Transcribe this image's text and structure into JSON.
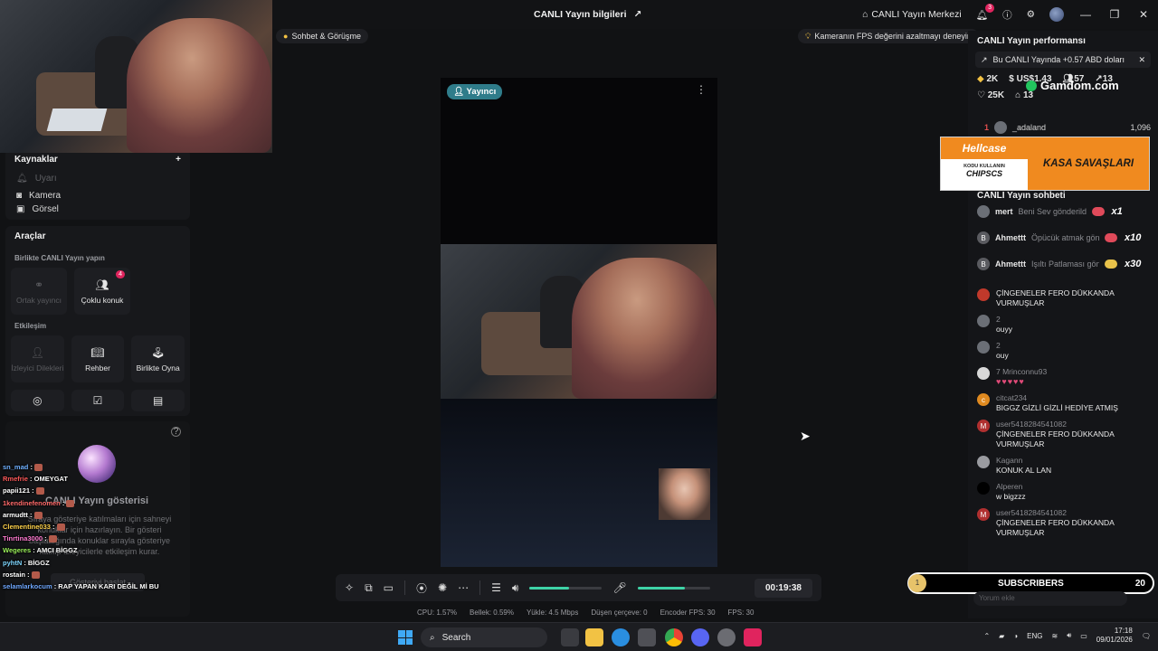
{
  "titlebar": {
    "title": "CANLI Yayın bilgileri",
    "live_center": "CANLI Yayın Merkezi",
    "notif_count": "3",
    "minimize": "—",
    "maximize": "❐",
    "close": "✕"
  },
  "top_chips": {
    "chat_call": "Sohbet & Görüşme",
    "fps_tip": "Kameranın FPS değerini azaltmayı deneyin"
  },
  "sources": {
    "title": "Kaynaklar",
    "add": "+",
    "items": [
      "Uyarı",
      "Kamera",
      "Görsel"
    ]
  },
  "tools": {
    "title": "Araçlar",
    "section_live_together": "Birlikte CANLI Yayın yapın",
    "co_host": "Ortak yayıncı",
    "multi_guest": "Çoklu konuk",
    "multi_guest_badge": "4",
    "section_interaction": "Etkileşim",
    "viewer_requests": "İzleyici Dilekleri",
    "guide": "Rehber",
    "play_together": "Birlikte Oyna"
  },
  "show": {
    "title": "CANLI Yayın gösterisi",
    "description": "Sıraya gösteriye katılmaları için sahneyi konuklar için hazırlayın. Bir gösteri başlattığında konuklar sırayla gösteriye katılıp izleyicilerle etkileşim kurar.",
    "start_button": "Gösteriyi başlat"
  },
  "overlay_chat": [
    {
      "name": "sn_mad",
      "msg": "",
      "color": "#6fb0ff"
    },
    {
      "name": "Rmefrie",
      "msg": "OMEYGAT",
      "color": "#ff5a5a"
    },
    {
      "name": "papii121",
      "msg": "",
      "color": "#ffffff"
    },
    {
      "name": "1kendinefenomen",
      "msg": "",
      "color": "#ff6a6a"
    },
    {
      "name": "armudtt",
      "msg": "",
      "color": "#ffffff"
    },
    {
      "name": "Clementine033",
      "msg": "",
      "color": "#ffd24a"
    },
    {
      "name": "Tinrtina3000",
      "msg": "",
      "color": "#ff7ad0"
    },
    {
      "name": "Wegeres",
      "msg": "AMCI BİGGZ",
      "color": "#9cf25b"
    },
    {
      "name": "pyhtN",
      "msg": "BİGGZ",
      "color": "#7fd7ff"
    },
    {
      "name": "rostain",
      "msg": "",
      "color": "#ffffff"
    },
    {
      "name": "selamlarkocum",
      "msg": "RAP YAPAN KARI DEĞİL Mİ BU",
      "color": "#6fa8ff"
    }
  ],
  "preview": {
    "host_tag": "Yayıncı",
    "menu": "⋮"
  },
  "controls": {
    "timer": "00:19:38",
    "volume_level": 0.55,
    "mic_level": 0.65
  },
  "stats": {
    "cpu": "CPU: 1.57%",
    "memory": "Bellek: 0.59%",
    "upload": "Yükle: 4.5 Mbps",
    "dropped": "Düşen çerçeve: 0",
    "encoder": "Encoder FPS: 30",
    "fps": "FPS: 30"
  },
  "right": {
    "perf_title": "CANLI Yayın performansı",
    "perf_note": "Bu CANLI Yayında +0.57 ABD doları",
    "stat_diamonds": "2K",
    "stat_usd": "US$1.43",
    "stat_users": "57",
    "stat_share": "13",
    "stat_likes": "25K",
    "stat_gifts": "13",
    "gamdom": "Gamdom.com",
    "rank_num": "1",
    "rank_name": "_adaland",
    "rank_value": "1,096",
    "hellcase": "Hellcase",
    "hellcase_small": "KODU KULLANIN",
    "hellcase_code": "CHIPSCS",
    "hellcase_banner": "KASA SAVAŞLARI",
    "chat_title": "CANLI Yayın sohbeti",
    "gifts": [
      {
        "user": "mert",
        "gift": "Beni Sev gönderildi",
        "count": "x1"
      },
      {
        "user": "Ahmettt",
        "gift": "Öpücük atmak gön",
        "count": "x10"
      },
      {
        "user": "Ahmettt",
        "gift": "Işıltı Patlaması gön",
        "count": "x30"
      }
    ],
    "messages": [
      {
        "name": "",
        "text": "ÇİNGENELER FERO DÜKKANDA VURMUŞLAR",
        "avatar": "#c0392b",
        "letter": ""
      },
      {
        "name": "2",
        "text": "ouyy",
        "avatar": "#6b6f76",
        "letter": ""
      },
      {
        "name": "2",
        "text": "ouy",
        "avatar": "#6b6f76",
        "letter": ""
      },
      {
        "name": "7  Mrinconnu93",
        "text": "♥♥♥♥♥",
        "avatar": "#d8d8d8",
        "letter": ""
      },
      {
        "name": "citcat234",
        "text": "BIGGZ GİZLİ GİZLİ HEDİYE ATMIŞ",
        "avatar": "#e08a20",
        "letter": "c"
      },
      {
        "name": "user5418284541082",
        "text": "ÇİNGENELER FERO DÜKKANDA VURMUŞLAR",
        "avatar": "#b03030",
        "letter": "M"
      },
      {
        "name": "Kagann",
        "text": "KONUK AL LAN",
        "avatar": "#9a9ba0",
        "letter": ""
      },
      {
        "name": "Alperen",
        "text": "w bigzzz",
        "avatar": "#000000",
        "letter": ""
      },
      {
        "name": "user5418284541082",
        "text": "ÇİNGENELER FERO DÜKKANDA VURMUŞLAR",
        "avatar": "#b03030",
        "letter": "M"
      }
    ],
    "subs_label": "SUBSCRIBERS",
    "subs_count": "20",
    "subs_level": "1",
    "comment_placeholder": "Yorum ekle"
  },
  "taskbar": {
    "search": "Search",
    "lang": "ENG",
    "time": "17:18",
    "date": "09/01/2026"
  }
}
